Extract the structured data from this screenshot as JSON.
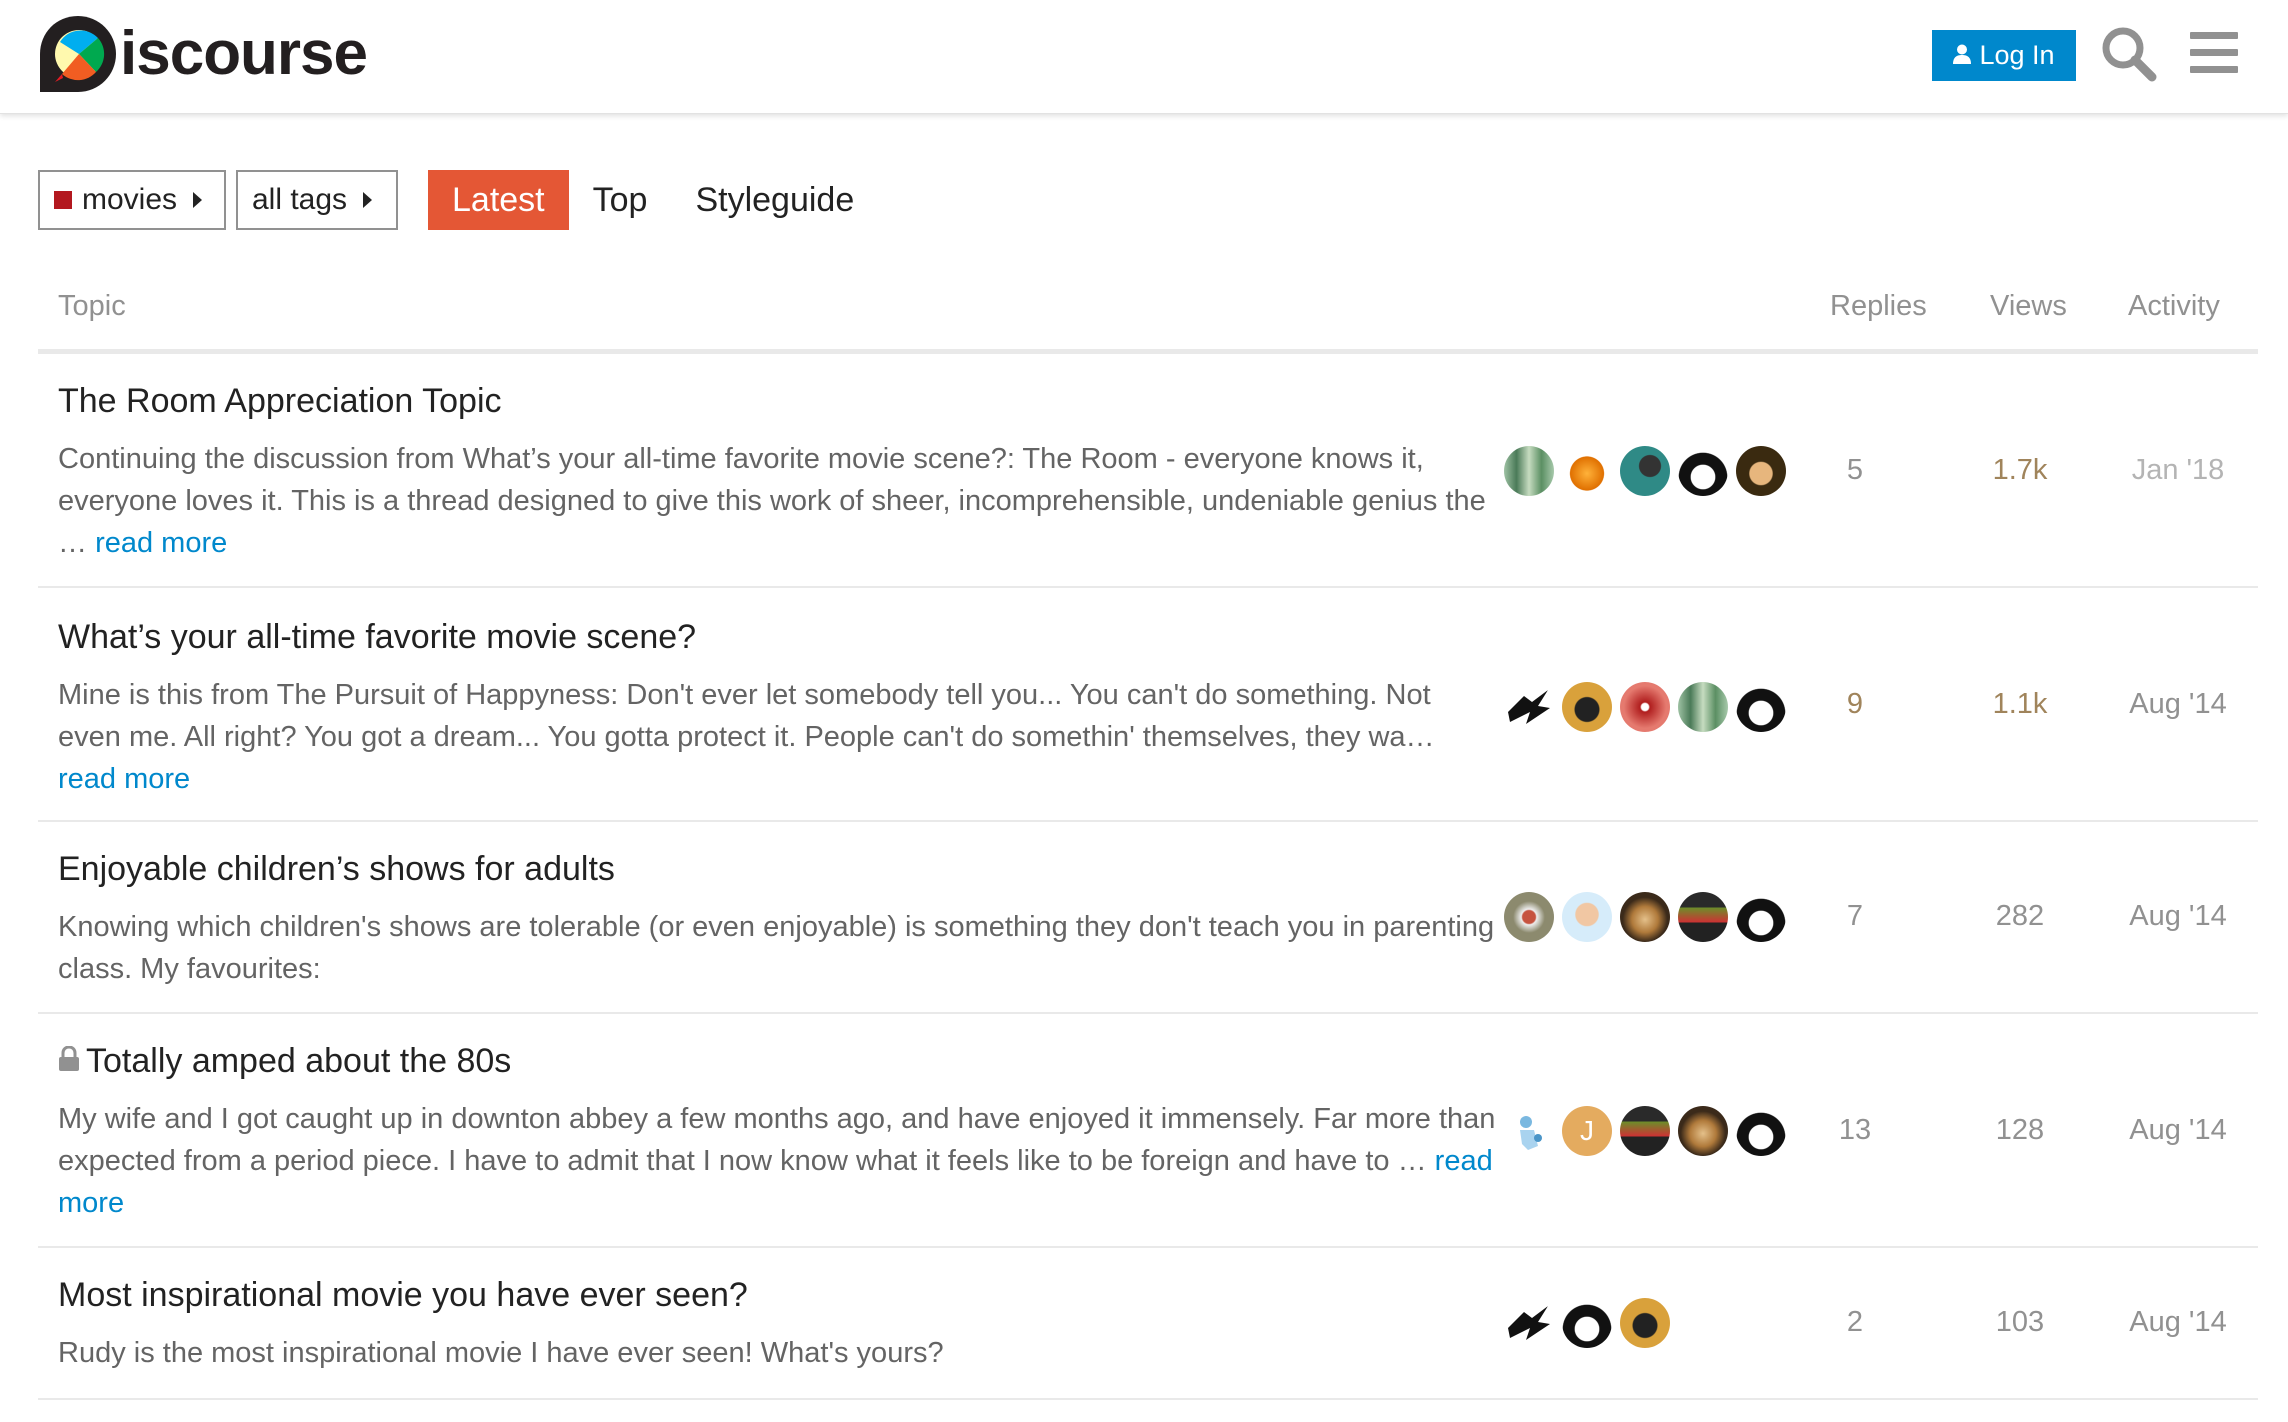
{
  "header": {
    "logo_text": "iscourse",
    "login_label": "Log In"
  },
  "nav": {
    "category": "movies",
    "tags": "all tags",
    "tabs": [
      "Latest",
      "Top",
      "Styleguide"
    ],
    "active_tab": "Latest"
  },
  "table": {
    "columns": {
      "topic": "Topic",
      "replies": "Replies",
      "views": "Views",
      "activity": "Activity"
    },
    "topics": [
      {
        "title": "The Room Appreciation Topic",
        "excerpt": "Continuing the discussion from What’s your all-time favorite movie scene?: The Room - everyone knows it, everyone loves it. This is a thread designed to give this work of sheer, incomprehensible, undeniable genius the …",
        "read_more": "read more",
        "replies": "5",
        "views": "1.7k",
        "activity": "Jan '18",
        "locked": false
      },
      {
        "title": "What’s your all-time favorite movie scene?",
        "excerpt": "Mine is this from The Pursuit of Happyness: Don't ever let somebody tell you... You can't do something. Not even me. All right? You got a dream... You gotta protect it. People can't do somethin' themselves, they wa…",
        "read_more": "read more",
        "replies": "9",
        "views": "1.1k",
        "activity": "Aug '14",
        "locked": false
      },
      {
        "title": "Enjoyable children’s shows for adults",
        "excerpt": "Knowing which children's shows are tolerable (or even enjoyable) is something they don't teach you in parenting class. My favourites:",
        "read_more": "",
        "replies": "7",
        "views": "282",
        "activity": "Aug '14",
        "locked": false
      },
      {
        "title": "Totally amped about the 80s",
        "excerpt": "My wife and I got caught up in downton abbey a few months ago, and have enjoyed it immensely. Far more than expected from a period piece. I have to admit that I now know what it feels like to be foreign and have to …",
        "read_more": "read more",
        "replies": "13",
        "views": "128",
        "activity": "Aug '14",
        "locked": true
      },
      {
        "title": "Most inspirational movie you have ever seen?",
        "excerpt": "Rudy is the most inspirational movie I have ever seen! What's yours?",
        "read_more": "",
        "replies": "2",
        "views": "103",
        "activity": "Aug '14",
        "locked": false
      }
    ]
  },
  "avatar_letter": "J",
  "colors": {
    "accent": "#0088cc",
    "active_tab": "#e45735",
    "category": "#b3181f",
    "heat": "#a0845b"
  }
}
